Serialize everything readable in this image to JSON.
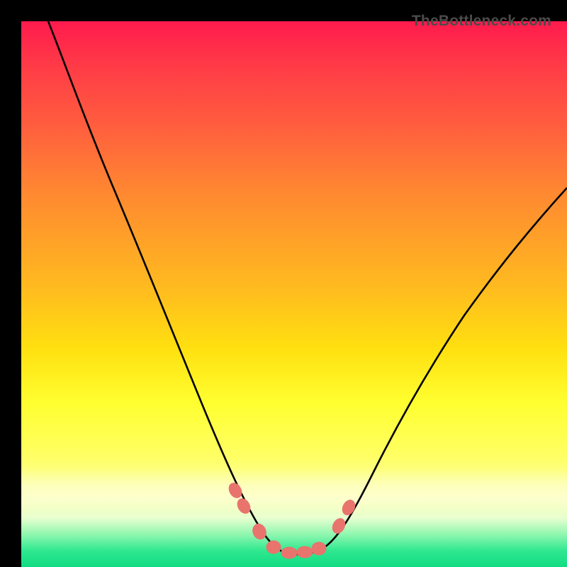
{
  "watermark": {
    "text": "TheBottleneck.com"
  },
  "colors": {
    "frame": "#000000",
    "curve_stroke": "#000000",
    "marker_fill": "#e8746d",
    "gradient_top": "#ff1a4d",
    "gradient_bottom": "#10dc82"
  },
  "chart_data": {
    "type": "line",
    "title": "",
    "xlabel": "",
    "ylabel": "",
    "xlim": [
      0,
      100
    ],
    "ylim": [
      0,
      100
    ],
    "note": "No axis ticks or labels visible; units unknown. Curve y estimated from pixel position (0=bottom, 100=top).",
    "series": [
      {
        "name": "curve",
        "x": [
          5,
          10,
          15,
          20,
          25,
          30,
          35,
          38,
          41,
          44,
          47,
          50,
          53,
          56,
          59,
          63,
          68,
          74,
          80,
          86,
          92,
          100
        ],
        "y": [
          100,
          88,
          76,
          63,
          50,
          37,
          25,
          16,
          10,
          6,
          3.5,
          2.5,
          2.5,
          3,
          5,
          10,
          18,
          28,
          38,
          47,
          55,
          65
        ]
      }
    ],
    "markers": {
      "name": "highlighted-points",
      "x": [
        39,
        41,
        44,
        47,
        50,
        53,
        55,
        58,
        60
      ],
      "y": [
        14,
        10,
        5,
        3,
        2.5,
        2.8,
        3.5,
        7,
        11
      ]
    }
  }
}
